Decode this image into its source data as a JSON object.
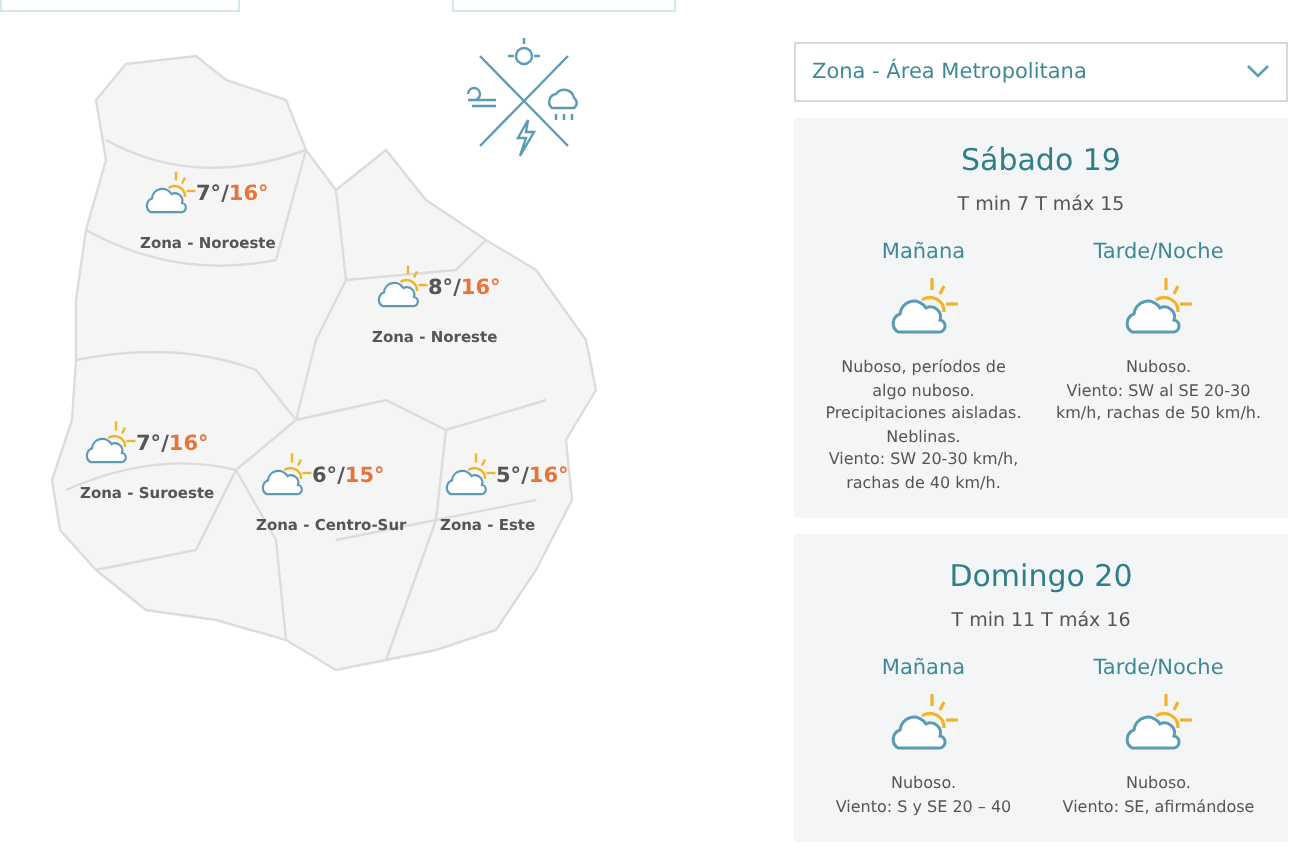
{
  "map": {
    "zones": [
      {
        "name": "Zona - Noroeste",
        "min": "7°",
        "sep": "/",
        "max": "16°"
      },
      {
        "name": "Zona - Noreste",
        "min": "8°",
        "sep": "/",
        "max": "16°"
      },
      {
        "name": "Zona - Suroeste",
        "min": "7°",
        "sep": "/",
        "max": "16°"
      },
      {
        "name": "Zona - Centro-Sur",
        "min": "6°",
        "sep": "/",
        "max": "15°"
      },
      {
        "name": "Zona - Este",
        "min": "5°",
        "sep": "/",
        "max": "16°"
      }
    ]
  },
  "zone_select": {
    "value": "Zona - Área Metropolitana"
  },
  "days": [
    {
      "title": "Sábado 19",
      "temps": "T min 7 T máx 15",
      "periods": [
        {
          "label": "Mañana",
          "lines": [
            "Nuboso, períodos de",
            "algo nuboso.",
            "Precipitaciones aisladas.",
            "Neblinas.",
            "Viento: SW 20-30 km/h,",
            "rachas de 40 km/h."
          ]
        },
        {
          "label": "Tarde/Noche",
          "lines": [
            "Nuboso.",
            "Viento: SW al SE 20-30",
            "km/h, rachas de 50 km/h."
          ]
        }
      ]
    },
    {
      "title": "Domingo 20",
      "temps": "T min 11 T máx 16",
      "periods": [
        {
          "label": "Mañana",
          "lines": [
            "Nuboso.",
            "Viento: S y SE 20 – 40"
          ]
        },
        {
          "label": "Tarde/Noche",
          "lines": [
            "Nuboso.",
            "Viento: SE, afirmándose"
          ]
        }
      ]
    }
  ]
}
